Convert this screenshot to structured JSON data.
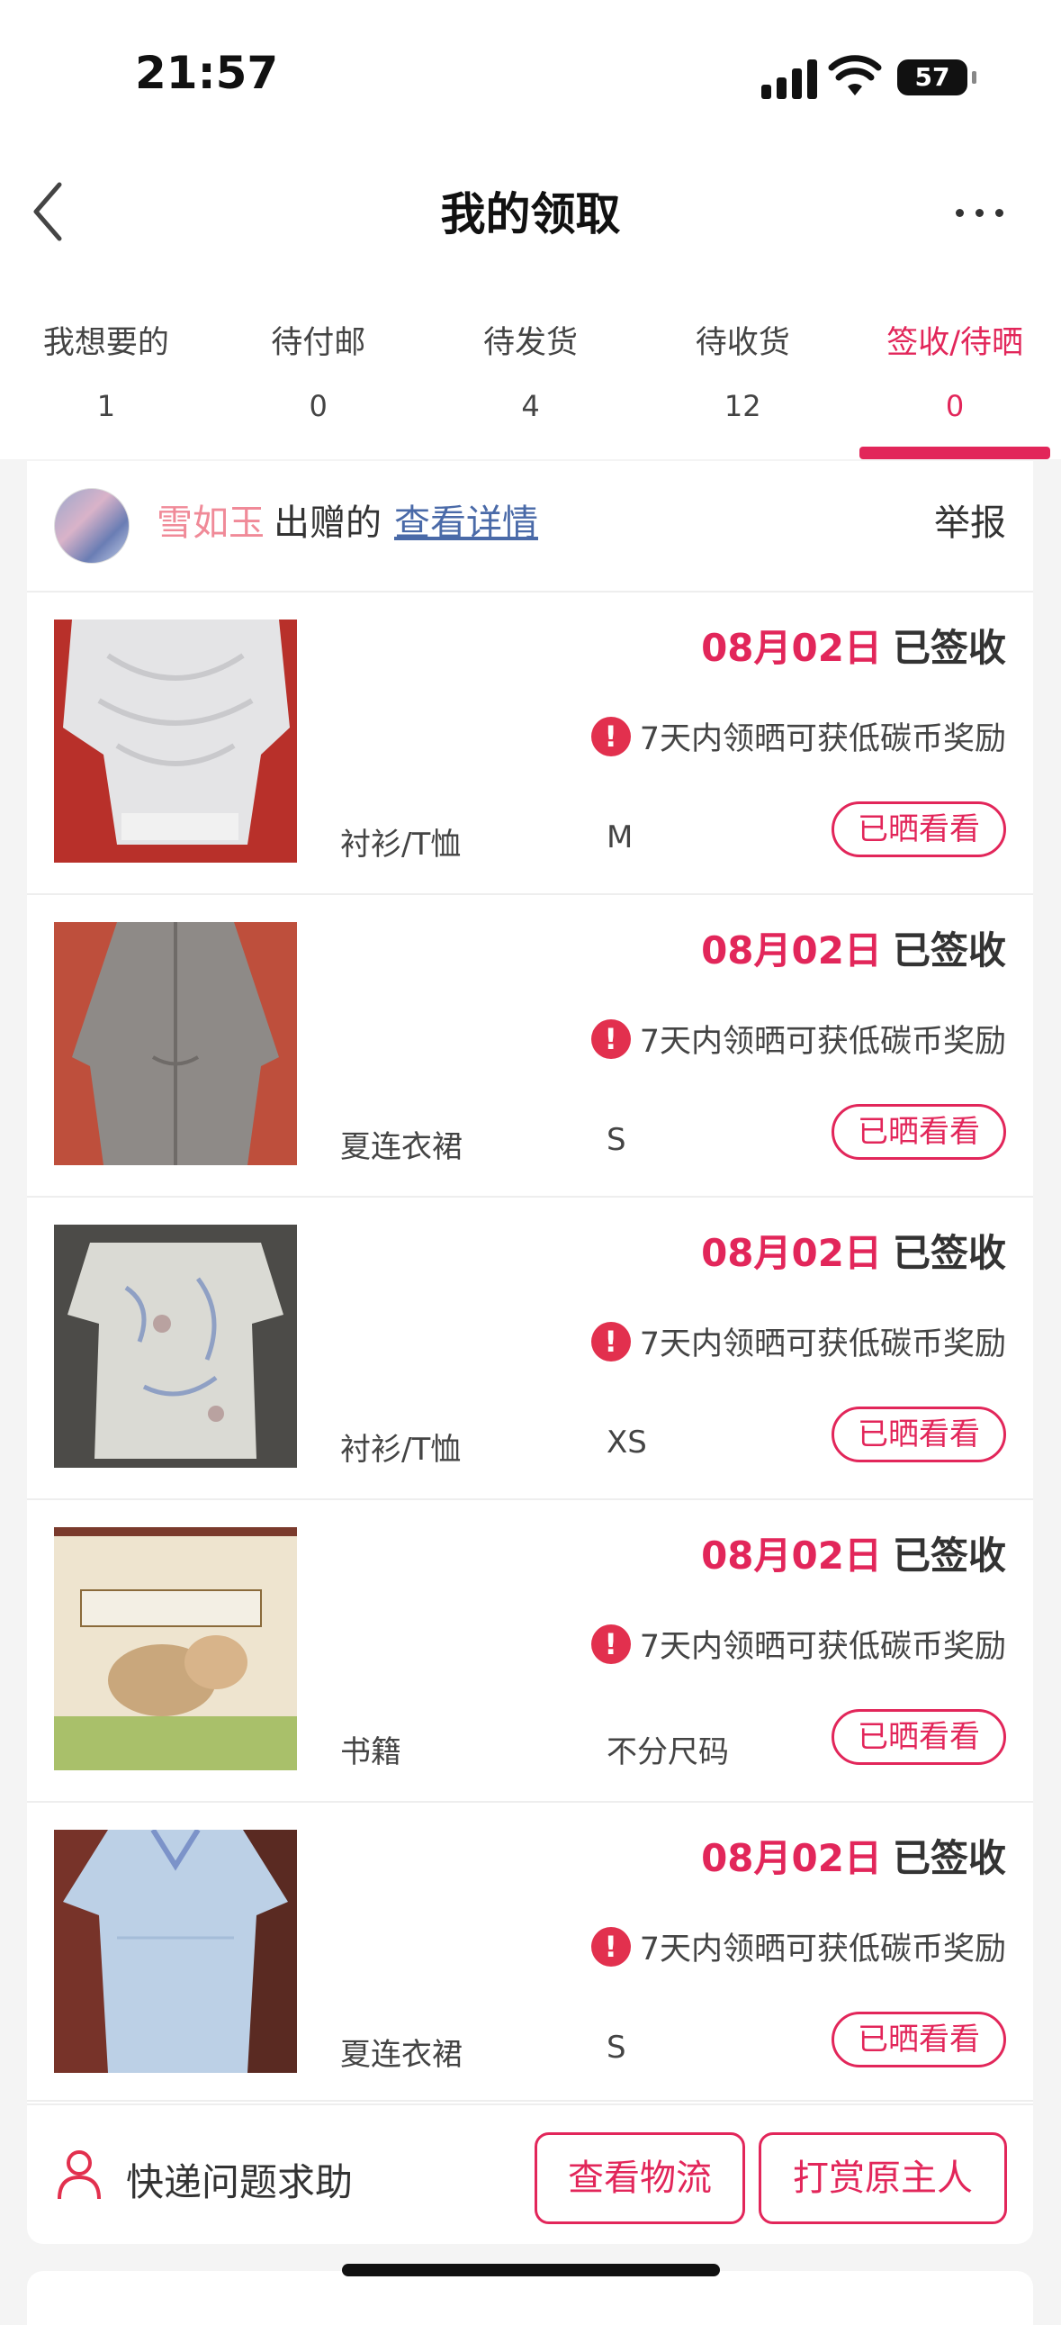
{
  "status_bar": {
    "time": "21:57",
    "battery": "57"
  },
  "header": {
    "title": "我的领取"
  },
  "tabs": [
    {
      "label": "我想要的",
      "count": "1"
    },
    {
      "label": "待付邮",
      "count": "0"
    },
    {
      "label": "待发货",
      "count": "4"
    },
    {
      "label": "待收货",
      "count": "12"
    },
    {
      "label": "签收/待晒",
      "count": "0"
    }
  ],
  "active_tab": "签收/待晒",
  "giver": {
    "name": "雪如玉",
    "verb": "出赠的",
    "detail_link": "查看详情",
    "report": "举报"
  },
  "items": [
    {
      "date": "08月02日",
      "status": "已签收",
      "reward_text": "7天内领晒可获低碳币奖励",
      "category": "衬衫/T恤",
      "size": "M",
      "button": "已晒看看"
    },
    {
      "date": "08月02日",
      "status": "已签收",
      "reward_text": "7天内领晒可获低碳币奖励",
      "category": "夏连衣裙",
      "size": "S",
      "button": "已晒看看"
    },
    {
      "date": "08月02日",
      "status": "已签收",
      "reward_text": "7天内领晒可获低碳币奖励",
      "category": "衬衫/T恤",
      "size": "XS",
      "button": "已晒看看"
    },
    {
      "date": "08月02日",
      "status": "已签收",
      "reward_text": "7天内领晒可获低碳币奖励",
      "category": "书籍",
      "size": "不分尺码",
      "button": "已晒看看"
    },
    {
      "date": "08月02日",
      "status": "已签收",
      "reward_text": "7天内领晒可获低碳币奖励",
      "category": "夏连衣裙",
      "size": "S",
      "button": "已晒看看"
    }
  ],
  "footer": {
    "help_label": "快递问题求助",
    "logistics_button": "查看物流",
    "tip_button": "打赏原主人"
  },
  "colors": {
    "accent": "#e2265a",
    "link": "#4a6aa8",
    "giver_name": "#f08a98"
  },
  "icons": [
    "back-arrow-icon",
    "more-icon",
    "warning-icon",
    "person-icon"
  ]
}
